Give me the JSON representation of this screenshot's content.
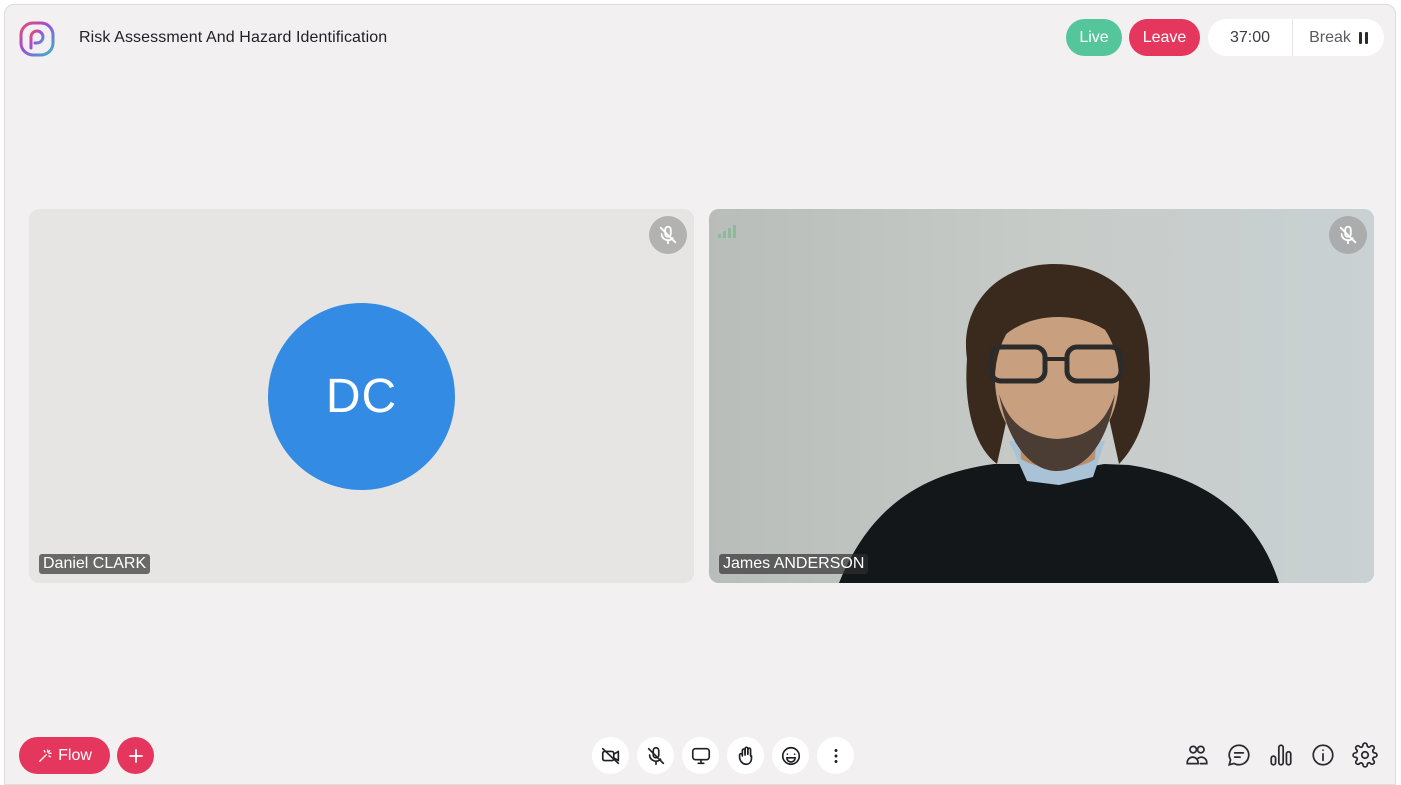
{
  "header": {
    "title": "Risk Assessment And Hazard Identification",
    "live_label": "Live",
    "leave_label": "Leave",
    "timer": "37:00",
    "break_label": "Break"
  },
  "tiles": [
    {
      "name": "Daniel CLARK",
      "initials": "DC",
      "muted": true,
      "camera": "off"
    },
    {
      "name": "James ANDERSON",
      "muted": true,
      "camera": "on"
    }
  ],
  "bottom_left": {
    "flow_label": "Flow"
  },
  "controls": [
    "camera-off-icon",
    "mic-off-icon",
    "screen-share-icon",
    "raise-hand-icon",
    "emoji-icon",
    "more-icon"
  ],
  "right_tools": [
    "participants-icon",
    "chat-icon",
    "poll-icon",
    "info-icon",
    "settings-icon"
  ],
  "colors": {
    "accent_red": "#e5375e",
    "live_green": "#55c59c",
    "avatar_blue": "#338be4",
    "background": "#f2f0f1"
  }
}
